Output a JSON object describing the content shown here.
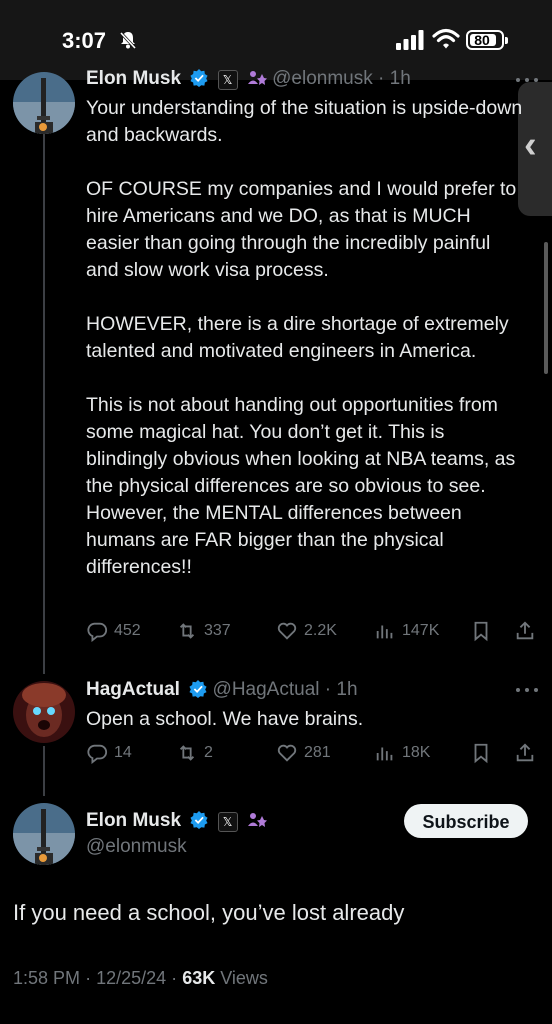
{
  "status_bar": {
    "time": "3:07",
    "battery": "80"
  },
  "reply_tweet": {
    "author_name": "Elon Musk",
    "handle": "@elonmusk",
    "separator": "·",
    "age": "1h",
    "text": "Your understanding of the situation is upside-down and backwards.\n\nOF COURSE my companies and I would prefer to hire Americans and we DO, as that is MUCH easier than going through the incredibly painful and slow work visa process.\n\nHOWEVER, there is a dire shortage of extremely talented and motivated engineers in America.\n\nThis is not about handing out opportunities from some magical hat. You don’t get it. This is blindingly obvious when looking at NBA teams, as the physical differences are so obvious to see. However, the MENTAL differences between humans are FAR bigger than the physical differences!!",
    "replies": "452",
    "reposts": "337",
    "likes": "2.2K",
    "views": "147K"
  },
  "hag_tweet": {
    "author_name": "HagActual",
    "handle": "@HagActual",
    "separator": "·",
    "age": "1h",
    "text": "Open a school. We have brains.",
    "replies": "14",
    "reposts": "2",
    "likes": "281",
    "views": "18K"
  },
  "main_tweet": {
    "author_name": "Elon Musk",
    "handle": "@elonmusk",
    "subscribe_label": "Subscribe",
    "text": "If you need a school, you’ve lost already",
    "time": "1:58 PM",
    "date": "12/25/24",
    "separator": "·",
    "views_count": "63K",
    "views_label": "Views"
  },
  "badges": {
    "x_badge": "𝕏"
  },
  "colors": {
    "background": "#000000",
    "verified": "#1d9bf0",
    "secondary_text": "#71767b",
    "affiliation": "#b07bd8"
  },
  "icons": [
    "bell-slash-icon",
    "signal-icon",
    "wifi-icon",
    "battery-icon",
    "verified-icon",
    "affiliation-icon",
    "reply-icon",
    "repost-icon",
    "like-icon",
    "views-icon",
    "bookmark-icon",
    "share-icon",
    "more-icon",
    "chevron-left-icon"
  ]
}
